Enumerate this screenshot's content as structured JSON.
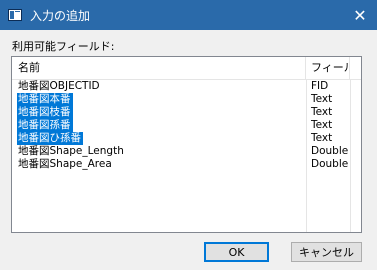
{
  "window": {
    "title": "入力の追加",
    "close_glyph": "✕",
    "icon": "dialog-app-icon"
  },
  "label": "利用可能フィールド:",
  "list": {
    "headers": {
      "name": "名前",
      "type": "フィール.."
    },
    "rows": [
      {
        "name": "地番図OBJECTID",
        "type": "FID",
        "selected": false
      },
      {
        "name": "地番図本番",
        "type": "Text",
        "selected": true
      },
      {
        "name": "地番図枝番",
        "type": "Text",
        "selected": true
      },
      {
        "name": "地番図孫番",
        "type": "Text",
        "selected": true
      },
      {
        "name": "地番図ひ孫番",
        "type": "Text",
        "selected": true
      },
      {
        "name": "地番図Shape_Length",
        "type": "Double",
        "selected": false
      },
      {
        "name": "地番図Shape_Area",
        "type": "Double",
        "selected": false
      }
    ]
  },
  "buttons": {
    "ok": "OK",
    "cancel": "キャンセル"
  },
  "colors": {
    "titlebar": "#2a6aaa",
    "selection": "#0078d7"
  }
}
